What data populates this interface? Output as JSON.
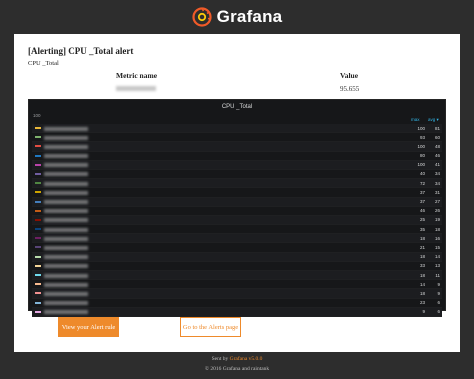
{
  "header": {
    "brand": "Grafana",
    "icon": "grafana-logo-icon"
  },
  "alert": {
    "title": "[Alerting] CPU _Total alert",
    "subtitle": "CPU _Total",
    "metric_header": "Metric name",
    "value_header": "Value",
    "value": "95.655"
  },
  "panel": {
    "title": "CPU _Total",
    "y_tick": "100",
    "legend_max": "max",
    "legend_avg": "avg ▾"
  },
  "colors": {
    "brand_orange": "#ee8a2b",
    "panel_bg": "#161719",
    "legend_header": "#33b5e5"
  },
  "chart_data": {
    "type": "table",
    "title": "CPU _Total",
    "columns": [
      "max",
      "avg"
    ],
    "rows": [
      {
        "color": "#eab839",
        "max": "100",
        "avg": "81"
      },
      {
        "color": "#7eb26d",
        "max": "93",
        "avg": "60"
      },
      {
        "color": "#e24d42",
        "max": "100",
        "avg": "48"
      },
      {
        "color": "#1f78c1",
        "max": "80",
        "avg": "46"
      },
      {
        "color": "#ba43a9",
        "max": "100",
        "avg": "41"
      },
      {
        "color": "#705da0",
        "max": "40",
        "avg": "34"
      },
      {
        "color": "#508642",
        "max": "72",
        "avg": "34"
      },
      {
        "color": "#cca300",
        "max": "37",
        "avg": "31"
      },
      {
        "color": "#447ebc",
        "max": "37",
        "avg": "27"
      },
      {
        "color": "#c15c17",
        "max": "46",
        "avg": "26"
      },
      {
        "color": "#890f02",
        "max": "25",
        "avg": "19"
      },
      {
        "color": "#0a437c",
        "max": "35",
        "avg": "18"
      },
      {
        "color": "#6d1f62",
        "max": "18",
        "avg": "16"
      },
      {
        "color": "#584477",
        "max": "21",
        "avg": "15"
      },
      {
        "color": "#b7dbab",
        "max": "18",
        "avg": "14"
      },
      {
        "color": "#f4d598",
        "max": "33",
        "avg": "13"
      },
      {
        "color": "#70dbed",
        "max": "18",
        "avg": "11"
      },
      {
        "color": "#f9ba8f",
        "max": "14",
        "avg": "9"
      },
      {
        "color": "#f29191",
        "max": "18",
        "avg": "9"
      },
      {
        "color": "#82b5d8",
        "max": "23",
        "avg": "6"
      },
      {
        "color": "#e5a8e2",
        "max": "9",
        "avg": "6"
      }
    ]
  },
  "buttons": {
    "view_rule": "View your Alert rule",
    "go_alerts": "Go to the Alerts page"
  },
  "footer": {
    "sent_by_prefix": "Sent by",
    "sent_by_link": "Grafana v5.0.0",
    "copyright": "© 2016 Grafana and raintank"
  }
}
